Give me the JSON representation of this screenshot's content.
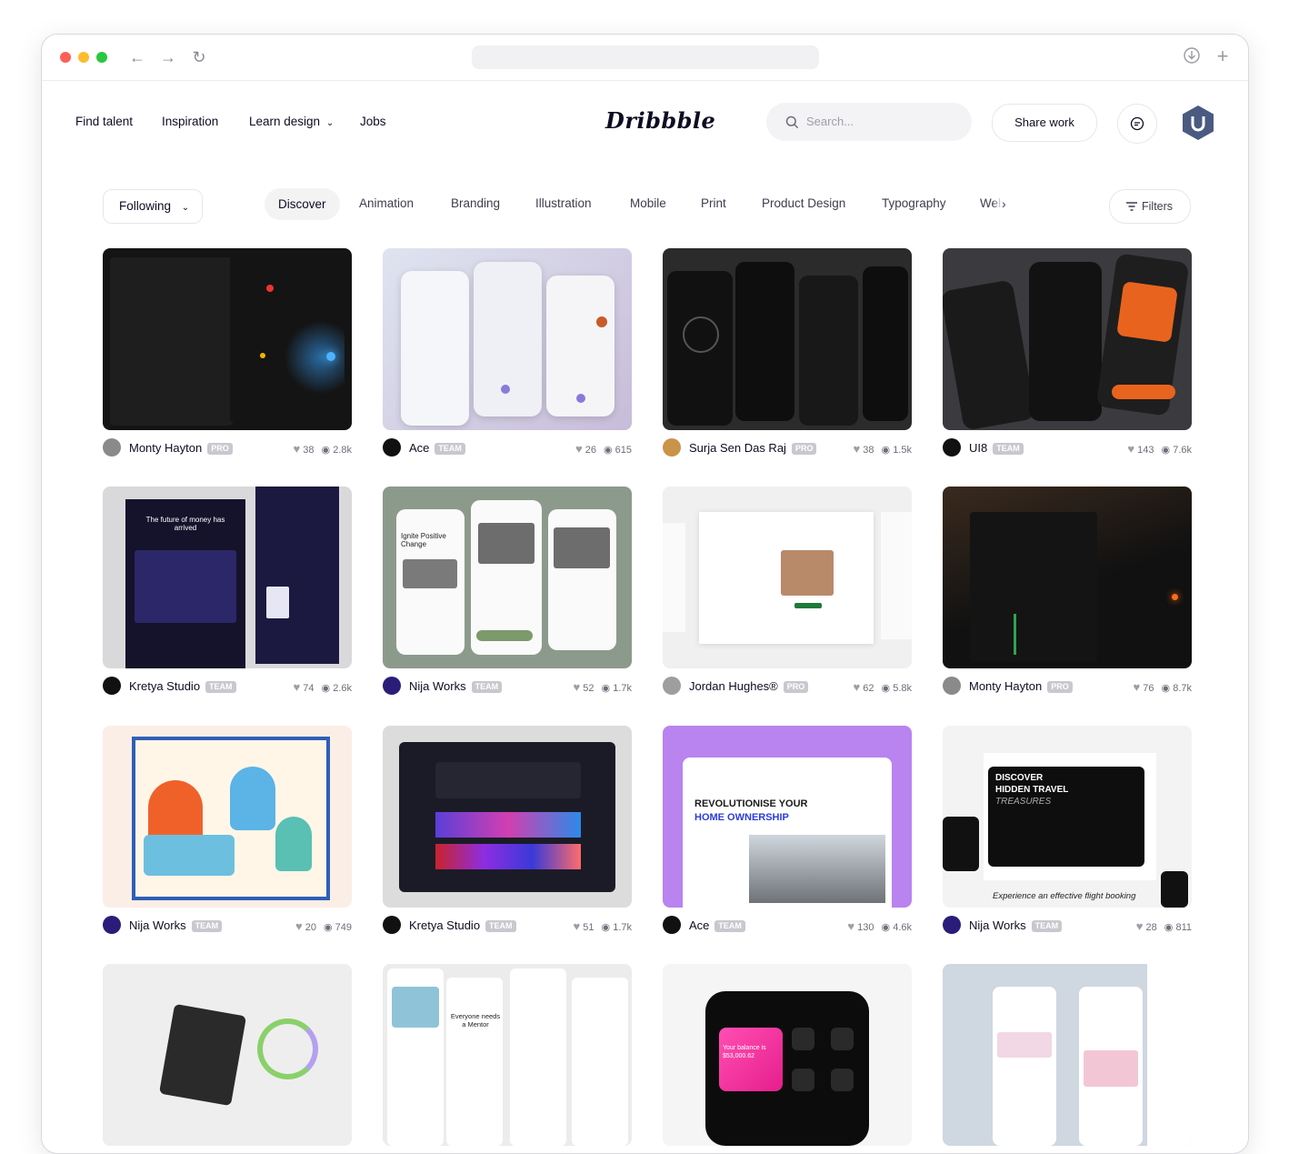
{
  "header": {
    "nav": [
      "Find talent",
      "Inspiration",
      "Learn design",
      "Jobs"
    ],
    "logo": "Dribbble",
    "search_placeholder": "Search...",
    "share_label": "Share work"
  },
  "filters_bar": {
    "following": "Following",
    "categories": [
      "Discover",
      "Animation",
      "Branding",
      "Illustration",
      "Mobile",
      "Print",
      "Product Design",
      "Typography",
      "Web"
    ],
    "filters_label": "Filters"
  },
  "shots": [
    {
      "author": "Monty Hayton",
      "badge": "PRO",
      "likes": "38",
      "views": "2.8k"
    },
    {
      "author": "Ace",
      "badge": "TEAM",
      "likes": "26",
      "views": "615"
    },
    {
      "author": "Surja Sen Das Raj",
      "badge": "PRO",
      "likes": "38",
      "views": "1.5k"
    },
    {
      "author": "UI8",
      "badge": "TEAM",
      "likes": "143",
      "views": "7.6k"
    },
    {
      "author": "Kretya Studio",
      "badge": "TEAM",
      "likes": "74",
      "views": "2.6k"
    },
    {
      "author": "Nija Works",
      "badge": "TEAM",
      "likes": "52",
      "views": "1.7k"
    },
    {
      "author": "Jordan Hughes®",
      "badge": "PRO",
      "likes": "62",
      "views": "5.8k"
    },
    {
      "author": "Monty Hayton",
      "badge": "PRO",
      "likes": "76",
      "views": "8.7k"
    },
    {
      "author": "Nija Works",
      "badge": "TEAM",
      "likes": "20",
      "views": "749"
    },
    {
      "author": "Kretya Studio",
      "badge": "TEAM",
      "likes": "51",
      "views": "1.7k"
    },
    {
      "author": "Ace",
      "badge": "TEAM",
      "likes": "130",
      "views": "4.6k"
    },
    {
      "author": "Nija Works",
      "badge": "TEAM",
      "likes": "28",
      "views": "811"
    }
  ],
  "shot_text": {
    "s5_headline": "The future of money has arrived",
    "s6_headline": "Ignite Positive Change",
    "s11_line1": "REVOLUTIONISE YOUR",
    "s11_line2": "HOME OWNERSHIP",
    "s12_line1": "DISCOVER",
    "s12_line2": "HIDDEN TRAVEL",
    "s12_line3": "TREASURES",
    "s12_caption": "Experience an effective flight booking",
    "s14_headline": "Everyone needs a Mentor",
    "s15_balance": "Your balance is $53,000.62"
  }
}
